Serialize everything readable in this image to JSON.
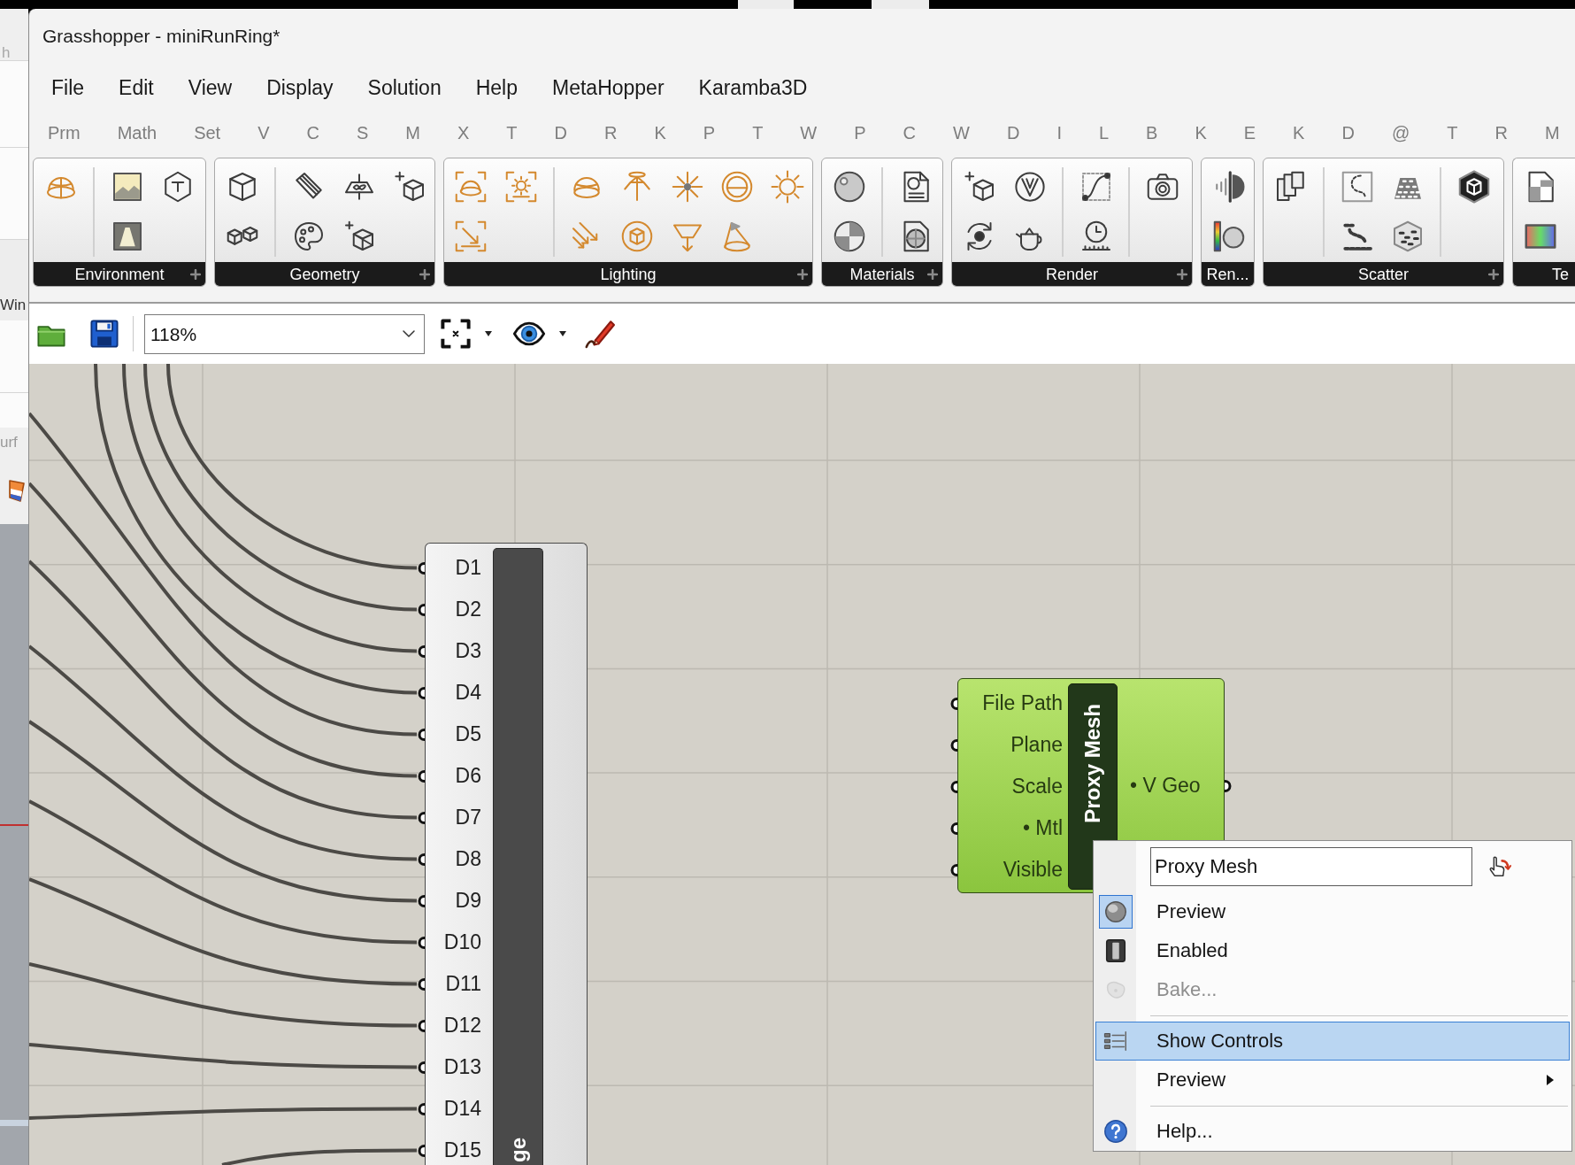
{
  "background_window": {
    "texts": [
      "h",
      "Win",
      "urf"
    ]
  },
  "window": {
    "title": "Grasshopper - miniRunRing*"
  },
  "menu_bar": [
    "File",
    "Edit",
    "View",
    "Display",
    "Solution",
    "Help",
    "MetaHopper",
    "Karamba3D"
  ],
  "tabs": [
    "Prm",
    "Math",
    "Set",
    "V",
    "C",
    "S",
    "M",
    "X",
    "T",
    "D",
    "R",
    "K",
    "P",
    "T",
    "W",
    "P",
    "C",
    "W",
    "D",
    "I",
    "L",
    "B",
    "K",
    "E",
    "K",
    "D",
    "@",
    "T",
    "R",
    "M"
  ],
  "ribbon": {
    "panels": [
      {
        "label": "Environment",
        "expander": true
      },
      {
        "label": "Geometry",
        "expander": true
      },
      {
        "label": "Lighting",
        "expander": true
      },
      {
        "label": "Materials",
        "expander": true
      },
      {
        "label": "Render",
        "expander": true
      },
      {
        "label": "Ren...",
        "expander": false
      },
      {
        "label": "Scatter",
        "expander": true
      },
      {
        "label": "Te",
        "expander": false
      }
    ]
  },
  "toolbar": {
    "zoom": {
      "value": "118%"
    }
  },
  "canvas": {
    "components": [
      {
        "name": "ge",
        "selected": false,
        "inputs": [
          {
            "label": "D1",
            "connected": true
          },
          {
            "label": "D2",
            "connected": true
          },
          {
            "label": "D3",
            "connected": true
          },
          {
            "label": "D4",
            "connected": true
          },
          {
            "label": "D5",
            "connected": true
          },
          {
            "label": "D6",
            "connected": true
          },
          {
            "label": "D7",
            "connected": true
          },
          {
            "label": "D8",
            "connected": true
          },
          {
            "label": "D9",
            "connected": true
          },
          {
            "label": "D10",
            "connected": true
          },
          {
            "label": "D11",
            "connected": true
          },
          {
            "label": "D12",
            "connected": true
          },
          {
            "label": "D13",
            "connected": true
          },
          {
            "label": "D14",
            "connected": true
          },
          {
            "label": "D15",
            "connected": true
          }
        ]
      },
      {
        "name": "Proxy Mesh",
        "selected": true,
        "inputs": [
          {
            "label": "File Path"
          },
          {
            "label": "Plane"
          },
          {
            "label": "Scale"
          },
          {
            "label": "• Mtl"
          },
          {
            "label": "Visible"
          }
        ],
        "outputs": [
          {
            "label": "• V Geo"
          }
        ]
      }
    ],
    "context_menu": {
      "name_field": {
        "value": "Proxy Mesh"
      },
      "items": [
        {
          "label": "Preview",
          "checked": true,
          "disabled": false,
          "selected": false,
          "separator_before": false,
          "submenu": false
        },
        {
          "label": "Enabled",
          "checked": false,
          "disabled": false,
          "selected": false,
          "separator_before": false,
          "submenu": false
        },
        {
          "label": "Bake...",
          "checked": false,
          "disabled": true,
          "selected": false,
          "separator_before": false,
          "submenu": false
        },
        {
          "label": "Show Controls",
          "checked": false,
          "disabled": false,
          "selected": true,
          "separator_before": true,
          "submenu": false
        },
        {
          "label": "Preview",
          "disabled": false,
          "selected": false,
          "separator_before": false,
          "submenu": true
        },
        {
          "label": "Help...",
          "checked": false,
          "disabled": false,
          "selected": false,
          "separator_before": true,
          "submenu": false
        }
      ]
    }
  }
}
